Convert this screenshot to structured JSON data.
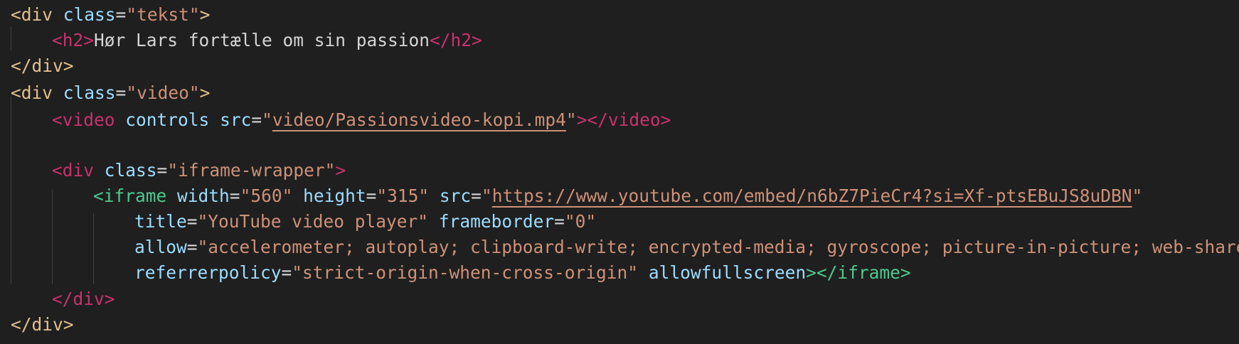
{
  "lines": [
    [
      [
        "<div",
        "tag-y"
      ],
      [
        " ",
        "text"
      ],
      [
        "class",
        "attr"
      ],
      [
        "=",
        "eq"
      ],
      [
        "\"tekst\"",
        "str"
      ],
      [
        ">",
        "tag-y"
      ]
    ],
    [
      [
        "<h2>",
        "tag-p"
      ],
      [
        "Hør Lars fortælle om sin passion",
        "text"
      ],
      [
        "</h2>",
        "tag-p"
      ]
    ],
    [
      [
        "</div>",
        "tag-y"
      ]
    ],
    [
      [
        "<div",
        "tag-y"
      ],
      [
        " ",
        "text"
      ],
      [
        "class",
        "attr"
      ],
      [
        "=",
        "eq"
      ],
      [
        "\"video\"",
        "str"
      ],
      [
        ">",
        "tag-y"
      ]
    ],
    [
      [
        "<video",
        "tag-p"
      ],
      [
        " ",
        "text"
      ],
      [
        "controls",
        "attr"
      ],
      [
        " ",
        "text"
      ],
      [
        "src",
        "attr"
      ],
      [
        "=",
        "eq"
      ],
      [
        "\"",
        "str"
      ],
      [
        "video/Passionsvideo-kopi.mp4",
        "str link"
      ],
      [
        "\"",
        "str"
      ],
      [
        "></video>",
        "tag-p"
      ]
    ],
    [],
    [
      [
        "<div",
        "tag-p"
      ],
      [
        " ",
        "text"
      ],
      [
        "class",
        "attr"
      ],
      [
        "=",
        "eq"
      ],
      [
        "\"iframe-wrapper\"",
        "str"
      ],
      [
        ">",
        "tag-p"
      ]
    ],
    [
      [
        "<iframe",
        "tag-g"
      ],
      [
        " ",
        "text"
      ],
      [
        "width",
        "attr"
      ],
      [
        "=",
        "eq"
      ],
      [
        "\"560\"",
        "str"
      ],
      [
        " ",
        "text"
      ],
      [
        "height",
        "attr"
      ],
      [
        "=",
        "eq"
      ],
      [
        "\"315\"",
        "str"
      ],
      [
        " ",
        "text"
      ],
      [
        "src",
        "attr"
      ],
      [
        "=",
        "eq"
      ],
      [
        "\"",
        "str"
      ],
      [
        "https://www.youtube.com/embed/n6bZ7PieCr4?si=Xf-ptsEBuJS8uDBN",
        "str link"
      ],
      [
        "\"",
        "str"
      ]
    ],
    [
      [
        "title",
        "attr"
      ],
      [
        "=",
        "eq"
      ],
      [
        "\"YouTube video player\"",
        "str"
      ],
      [
        " ",
        "text"
      ],
      [
        "frameborder",
        "attr"
      ],
      [
        "=",
        "eq"
      ],
      [
        "\"0\"",
        "str"
      ]
    ],
    [
      [
        "allow",
        "attr"
      ],
      [
        "=",
        "eq"
      ],
      [
        "\"accelerometer; autoplay; clipboard-write; encrypted-media; gyroscope; picture-in-picture; web-share\"",
        "str"
      ]
    ],
    [
      [
        "referrerpolicy",
        "attr"
      ],
      [
        "=",
        "eq"
      ],
      [
        "\"strict-origin-when-cross-origin\"",
        "str"
      ],
      [
        " ",
        "text"
      ],
      [
        "allowfullscreen",
        "attr"
      ],
      [
        "></iframe>",
        "tag-g"
      ]
    ],
    [
      [
        "</div>",
        "tag-p"
      ]
    ],
    [
      [
        "</div>",
        "tag-y"
      ]
    ]
  ],
  "colors": {
    "background": "#1f1f1f",
    "tag_yellow": "#e2c08d",
    "tag_pink": "#c8326f",
    "tag_green": "#4ec98f",
    "attribute": "#9cdcfe",
    "string": "#ce9178",
    "text": "#d4d4d4"
  }
}
